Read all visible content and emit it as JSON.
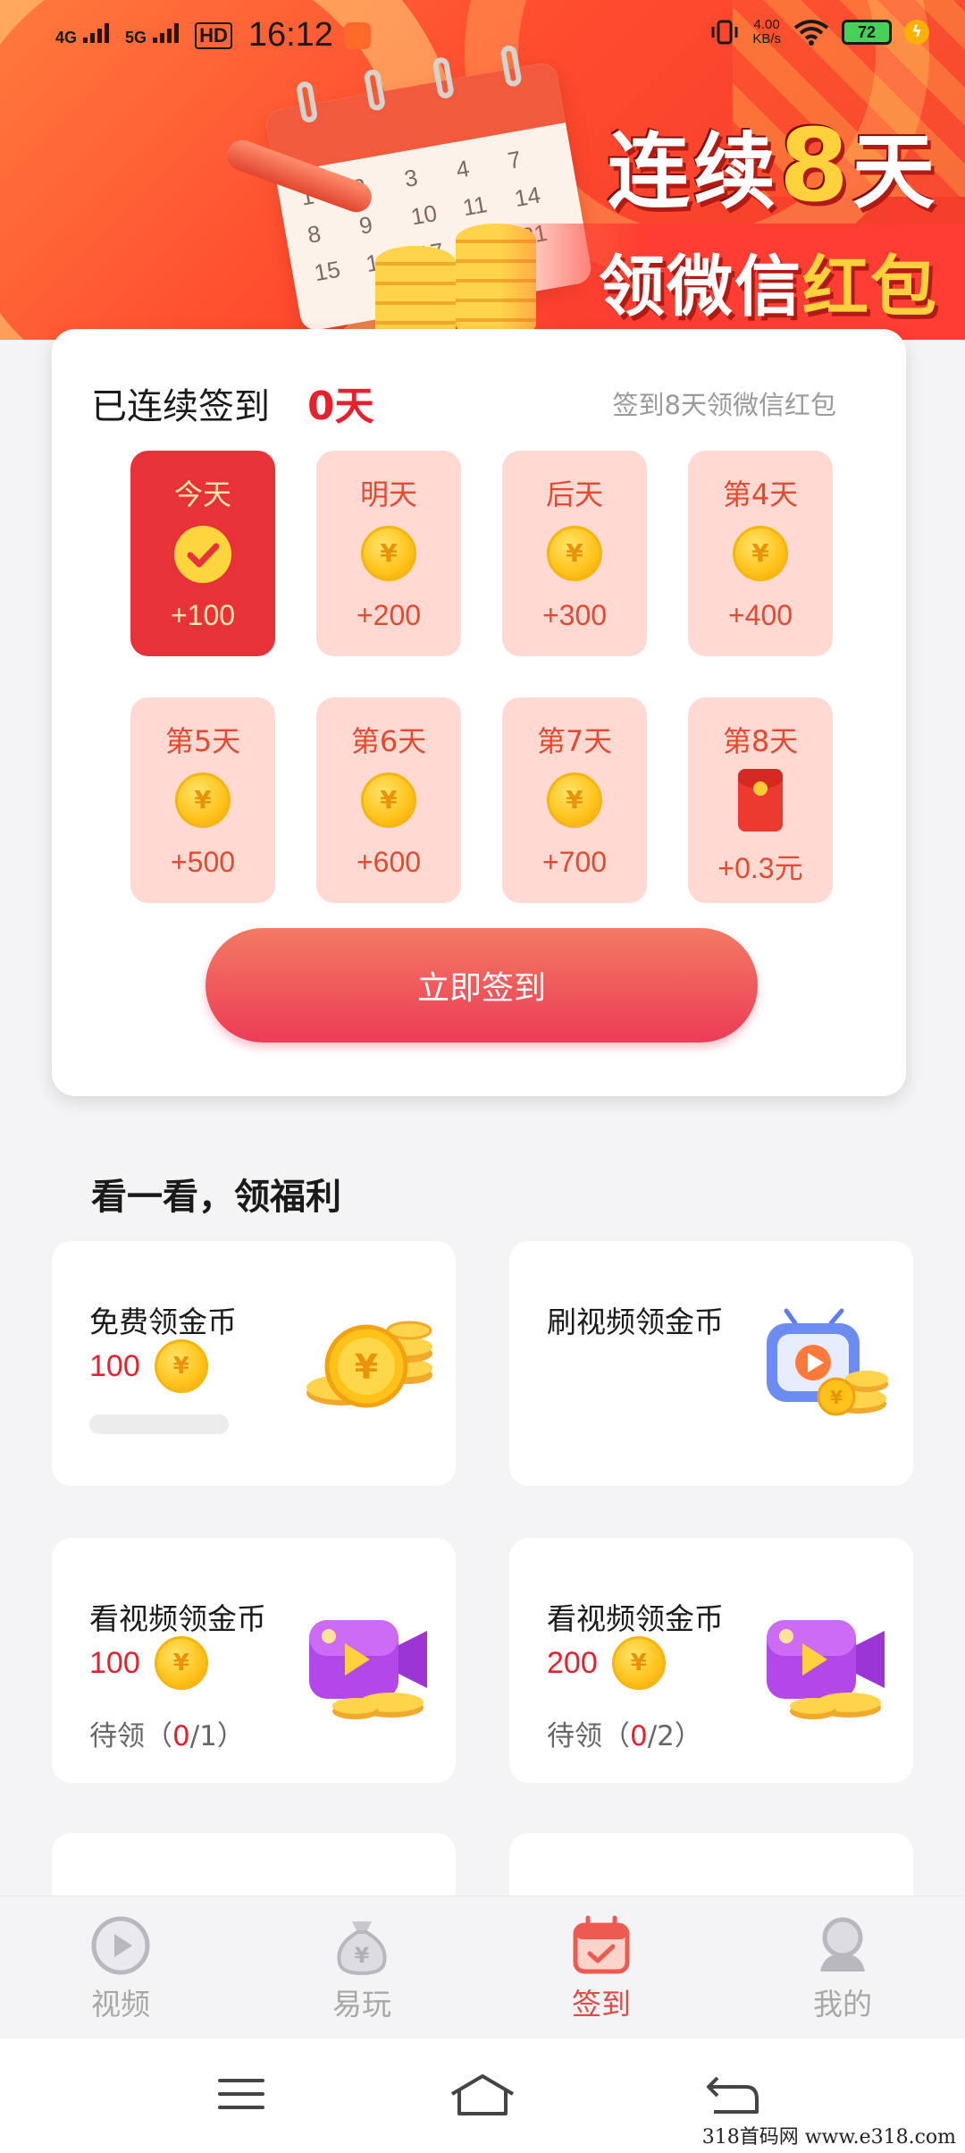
{
  "status_bar": {
    "signal1": "4G",
    "signal2": "5G",
    "hd": "HD",
    "time": "16:12",
    "speed_value": "4.00",
    "speed_unit": "KB/s",
    "battery": "72"
  },
  "banner": {
    "line1_prefix": "连续",
    "line1_number": "8",
    "line1_suffix": "天",
    "line2_main": "领微信",
    "line2_highlight": "红包",
    "calendar_numbers": [
      "1",
      "2",
      "3",
      "4",
      "7",
      "8",
      "9",
      "10",
      "11",
      "14",
      "15",
      "16",
      "17",
      "18",
      "21"
    ]
  },
  "signin": {
    "title": "已连续签到",
    "days_count": "0天",
    "hint": "签到8天领微信红包",
    "days": [
      {
        "label": "今天",
        "reward": "+100",
        "icon": "check-icon",
        "active": true
      },
      {
        "label": "明天",
        "reward": "+200",
        "icon": "coin-icon",
        "active": false
      },
      {
        "label": "后天",
        "reward": "+300",
        "icon": "coin-icon",
        "active": false
      },
      {
        "label": "第4天",
        "reward": "+400",
        "icon": "coin-icon",
        "active": false
      },
      {
        "label": "第5天",
        "reward": "+500",
        "icon": "coin-icon",
        "active": false
      },
      {
        "label": "第6天",
        "reward": "+600",
        "icon": "coin-icon",
        "active": false
      },
      {
        "label": "第7天",
        "reward": "+700",
        "icon": "coin-icon",
        "active": false
      },
      {
        "label": "第8天",
        "reward": "+0.3元",
        "icon": "red-packet-icon",
        "active": false
      }
    ],
    "coin_symbol": "¥",
    "button_label": "立即签到"
  },
  "tasks": {
    "section_title": "看一看，领福利",
    "items": [
      {
        "title": "免费领金币",
        "amount": "100",
        "status_prefix": "",
        "status_done": "",
        "status_total": "",
        "art": "coin-pile-icon"
      },
      {
        "title": "刷视频领金币",
        "amount": "",
        "status_prefix": "",
        "status_done": "",
        "status_total": "",
        "art": "tv-coins-icon"
      },
      {
        "title": "看视频领金币",
        "amount": "100",
        "status_prefix": "待领（",
        "status_done": "0",
        "status_total": "/1）",
        "art": "video-camera-icon"
      },
      {
        "title": "看视频领金币",
        "amount": "200",
        "status_prefix": "待领（",
        "status_done": "0",
        "status_total": "/2）",
        "art": "video-camera-icon"
      }
    ]
  },
  "tabbar": {
    "items": [
      {
        "label": "视频",
        "icon": "play-circle-icon",
        "active": false
      },
      {
        "label": "易玩",
        "icon": "money-bag-icon",
        "active": false
      },
      {
        "label": "签到",
        "icon": "calendar-check-icon",
        "active": true
      },
      {
        "label": "我的",
        "icon": "profile-icon",
        "active": false
      }
    ]
  },
  "system_nav": {
    "menu": "menu-icon",
    "home": "home-icon",
    "back": "back-icon"
  },
  "watermark": "318首码网  www.e318.com",
  "colors": {
    "accent_red": "#e8202e",
    "tile_active": "#e8323a",
    "tile_inactive": "#ffd9d2",
    "button_gradient_top": "#f37a63",
    "button_gradient_bottom": "#ec3c56",
    "coin_gold": "#ffc21a"
  }
}
